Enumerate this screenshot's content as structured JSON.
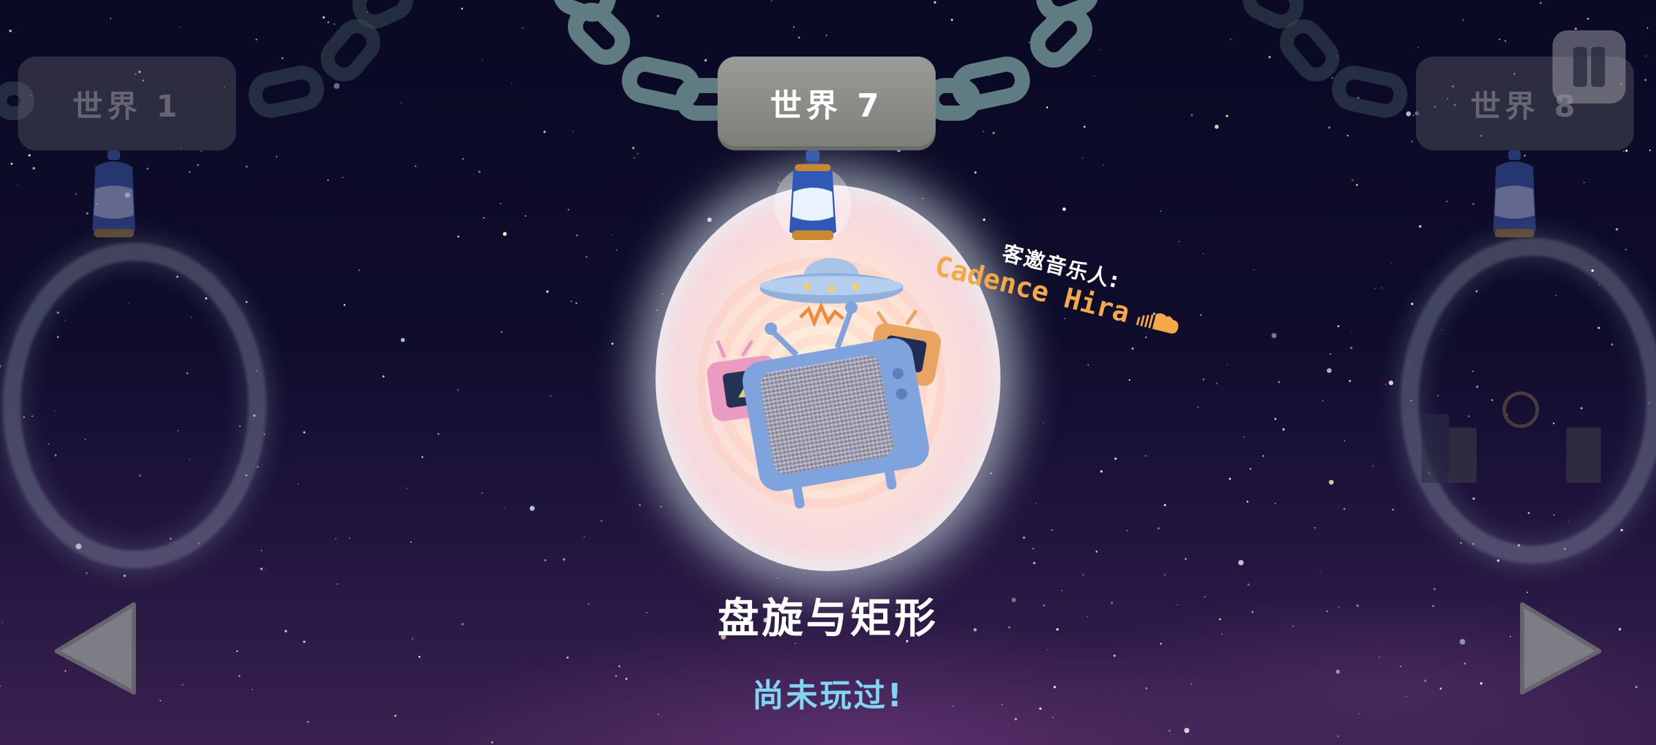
{
  "worlds": {
    "left": {
      "label": "世界 1"
    },
    "current": {
      "label": "世界 7"
    },
    "right": {
      "label": "世界 8"
    }
  },
  "level": {
    "title": "盘旋与矩形",
    "status": "尚未玩过!"
  },
  "guest_musician": {
    "label": "客邀音乐人:",
    "name": "Cadence Hira",
    "icon": "soundcloud-icon"
  },
  "controls": {
    "pause_icon": "pause-icon",
    "prev_icon": "arrow-left-icon",
    "next_icon": "arrow-right-icon"
  },
  "colors": {
    "title_text": "#ffffff",
    "status_text": "#7fd6f0",
    "musician_name": "#f3a948",
    "sky_top": "#0a0a24",
    "sky_bottom": "#3a2150"
  }
}
